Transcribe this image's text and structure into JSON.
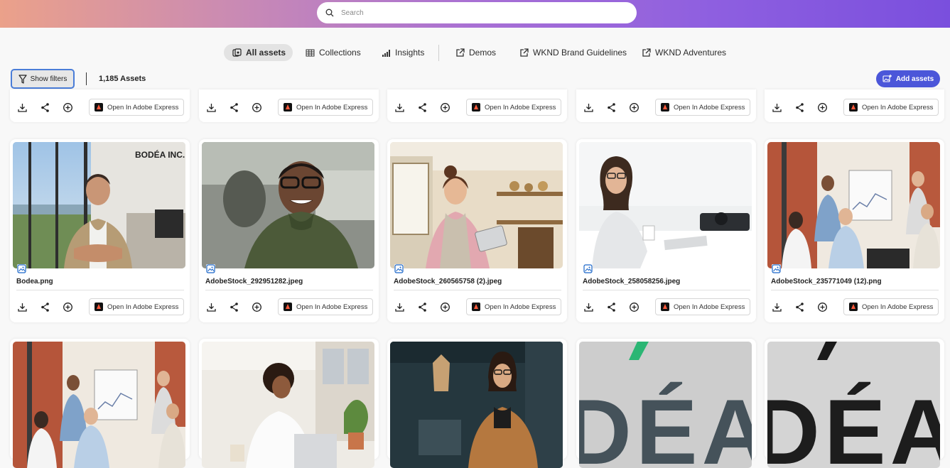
{
  "search": {
    "placeholder": "Search"
  },
  "nav": {
    "items": [
      {
        "label": "All assets",
        "icon": "all-assets-icon",
        "active": true
      },
      {
        "label": "Collections",
        "icon": "grid-icon"
      },
      {
        "label": "Insights",
        "icon": "bar-chart-icon"
      },
      {
        "label": "Demos",
        "icon": "external-link-icon"
      },
      {
        "label": "WKND Brand Guidelines",
        "icon": "external-link-icon"
      },
      {
        "label": "WKND Adventures",
        "icon": "external-link-icon"
      }
    ]
  },
  "toolbar": {
    "show_filters": "Show filters",
    "asset_count": "1,185 Assets",
    "add_assets": "Add assets"
  },
  "card_action_label": "Open In Adobe Express",
  "cards_row2": [
    {
      "name": "Bodea.png",
      "image": "man-crossed-arms-office-bodea"
    },
    {
      "name": "AdobeStock_292951282.jpeg",
      "image": "smiling-man-glasses"
    },
    {
      "name": "AdobeStock_260565758 (2).jpeg",
      "image": "woman-cafe-tablet"
    },
    {
      "name": "AdobeStock_258058256.jpeg",
      "image": "woman-glasses-desk"
    },
    {
      "name": "AdobeStock_235771049 (12).png",
      "image": "office-meeting-whiteboard"
    }
  ],
  "cards_row3": [
    {
      "image": "office-meeting-whiteboard"
    },
    {
      "image": "woman-curly-hair-laptop"
    },
    {
      "image": "woman-glasses-orange-sweater"
    },
    {
      "image": "bodea-logo-crop"
    },
    {
      "image": "bodea-logo-crop"
    }
  ],
  "thumb_text": {
    "bodea_sign": "BODÉA INC.",
    "logo_crop": "DÉA I"
  },
  "colors": {
    "accent": "#4b56d9",
    "focus_ring": "#4a7dd8",
    "header_gradient_start": "#eba18a",
    "header_gradient_end": "#7a4fdd"
  }
}
